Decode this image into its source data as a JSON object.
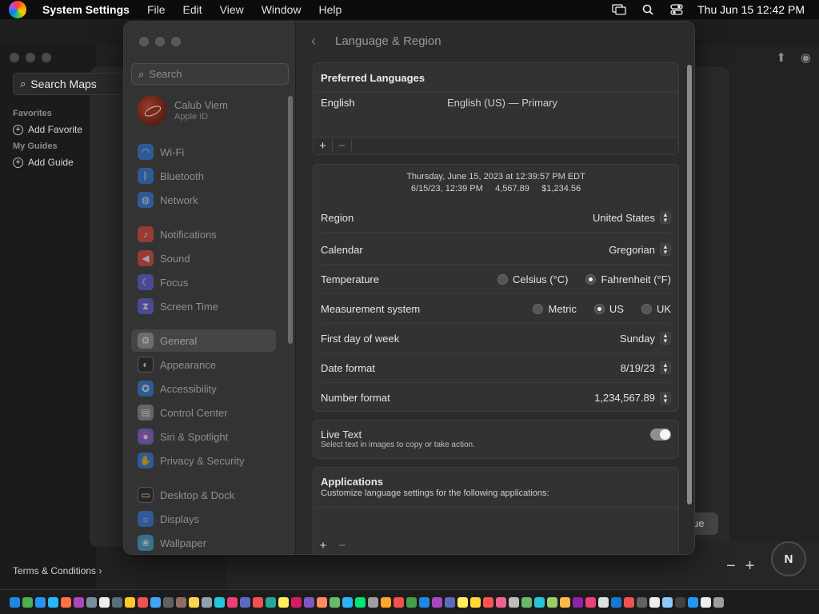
{
  "menubar": {
    "app_name": "System Settings",
    "menus": [
      "File",
      "Edit",
      "View",
      "Window",
      "Help"
    ],
    "clock": "Thu Jun 15  12:42 PM"
  },
  "maps": {
    "search_placeholder": "Search Maps",
    "favorites_header": "Favorites",
    "add_favorite": "Add Favorite",
    "guides_header": "My Guides",
    "add_guide": "Add Guide",
    "terms": "Terms & Conditions",
    "continue_label": "ue",
    "compass": "N"
  },
  "settings": {
    "search_placeholder": "Search",
    "account": {
      "name": "Calub Viem",
      "sub": "Apple ID"
    },
    "sidebar": [
      {
        "label": "Wi-Fi",
        "icon": "wifi-icon",
        "color": "#2b7be8"
      },
      {
        "label": "Bluetooth",
        "icon": "bluetooth-icon",
        "color": "#2b7be8"
      },
      {
        "label": "Network",
        "icon": "globe-icon",
        "color": "#2b7be8"
      },
      {
        "label": "Notifications",
        "icon": "bell-icon",
        "color": "#e8453c"
      },
      {
        "label": "Sound",
        "icon": "speaker-icon",
        "color": "#e8453c"
      },
      {
        "label": "Focus",
        "icon": "moon-icon",
        "color": "#5e5ce6"
      },
      {
        "label": "Screen Time",
        "icon": "hourglass-icon",
        "color": "#5e5ce6"
      },
      {
        "label": "General",
        "icon": "gear-icon",
        "color": "#8e8e93"
      },
      {
        "label": "Appearance",
        "icon": "appearance-icon",
        "color": "#1c1c1e"
      },
      {
        "label": "Accessibility",
        "icon": "accessibility-icon",
        "color": "#2b7be8"
      },
      {
        "label": "Control Center",
        "icon": "control-center-icon",
        "color": "#8e8e93"
      },
      {
        "label": "Siri & Spotlight",
        "icon": "siri-icon",
        "color": "#b34fd8"
      },
      {
        "label": "Privacy & Security",
        "icon": "hand-icon",
        "color": "#2b7be8"
      },
      {
        "label": "Desktop & Dock",
        "icon": "dock-icon",
        "color": "#1c1c1e"
      },
      {
        "label": "Displays",
        "icon": "display-icon",
        "color": "#2b7be8"
      },
      {
        "label": "Wallpaper",
        "icon": "wallpaper-icon",
        "color": "#39a7d9"
      }
    ],
    "selected": "General",
    "page_title": "Language & Region",
    "preferred": {
      "header": "Preferred Languages",
      "language": "English",
      "language_detail": "English (US) — Primary"
    },
    "preview": {
      "line1": "Thursday, June 15, 2023 at 12:39:57 PM EDT",
      "line2": "6/15/23, 12:39 PM     4,567.89     $1,234.56"
    },
    "rows": {
      "region": {
        "label": "Region",
        "value": "United States"
      },
      "calendar": {
        "label": "Calendar",
        "value": "Gregorian"
      },
      "temperature": {
        "label": "Temperature",
        "opt1": "Celsius (°C)",
        "opt2": "Fahrenheit (°F)"
      },
      "measurement": {
        "label": "Measurement system",
        "opt1": "Metric",
        "opt2": "US",
        "opt3": "UK"
      },
      "first_day": {
        "label": "First day of week",
        "value": "Sunday"
      },
      "date_format": {
        "label": "Date format",
        "value": "8/19/23"
      },
      "number_format": {
        "label": "Number format",
        "value": "1,234,567.89"
      }
    },
    "live_text": {
      "title": "Live Text",
      "desc": "Select text in images to copy or take action.",
      "on": true
    },
    "applications": {
      "title": "Applications",
      "desc": "Customize language settings for the following applications:"
    }
  },
  "dock_colors": [
    "#1e88e5",
    "#4caf50",
    "#2196f3",
    "#29b6f6",
    "#ff7043",
    "#ab47bc",
    "#78909c",
    "#eeeeee",
    "#546e7a",
    "#ffca28",
    "#ef5350",
    "#42a5f5",
    "#616161",
    "#8d6e63",
    "#ffd54f",
    "#90a4ae",
    "#26c6da",
    "#ec407a",
    "#5c6bc0",
    "#ef5350",
    "#26a69a",
    "#ffee58",
    "#d81b60",
    "#7e57c2",
    "#ff8a65",
    "#66bb6a",
    "#29b6f6",
    "#00e676",
    "#9e9e9e",
    "#ffa726",
    "#ef5350",
    "#43a047",
    "#1e88e5",
    "#ab47bc",
    "#5c6bc0",
    "#ffee58",
    "#fdd835",
    "#ff5252",
    "#f06292",
    "#bdbdbd",
    "#66bb6a",
    "#26c6da",
    "#9ccc65",
    "#ffb74d",
    "#8e24aa",
    "#ec407a",
    "#e0e0e0",
    "#1976d2",
    "#ef5350",
    "#616161",
    "#eeeeee",
    "#90caf9",
    "#424242",
    "#2196f3",
    "#eeeeee",
    "#9e9e9e"
  ]
}
